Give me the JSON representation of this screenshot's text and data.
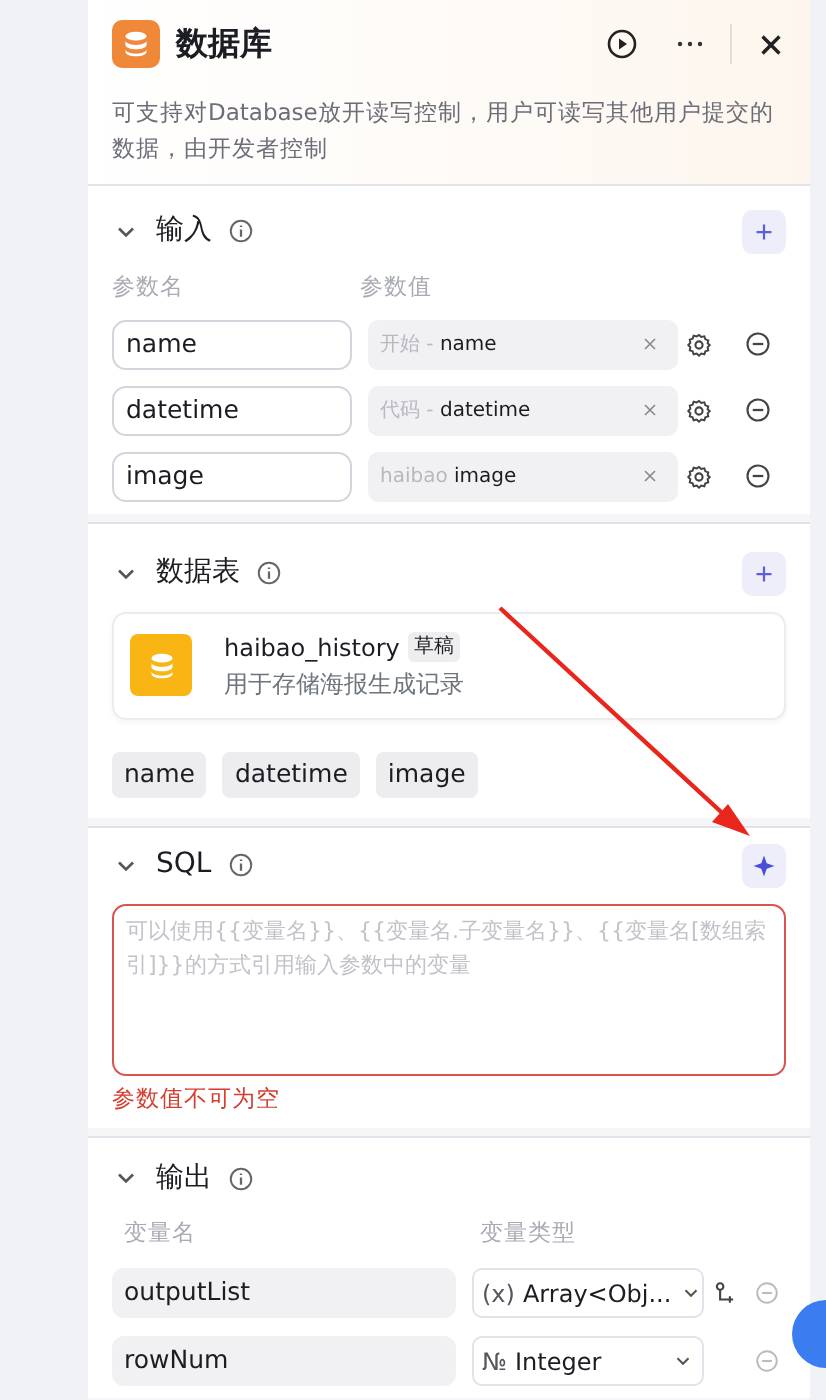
{
  "header": {
    "title": "数据库",
    "description": "可支持对Database放开读写控制，用户可读写其他用户提交的数据，由开发者控制"
  },
  "input": {
    "title": "输入",
    "expanded": true,
    "col_name": "参数名",
    "col_value": "参数值",
    "rows": [
      {
        "name": "name",
        "source": "开始 -",
        "variable": "name"
      },
      {
        "name": "datetime",
        "source": "代码 -",
        "variable": "datetime"
      },
      {
        "name": "image",
        "source": "haibao",
        "variable": "image"
      }
    ]
  },
  "table": {
    "title": "数据表",
    "expanded": true,
    "name": "haibao_history",
    "badge": "草稿",
    "description": "用于存储海报生成记录",
    "fields": [
      "name",
      "datetime",
      "image"
    ]
  },
  "sql": {
    "title": "SQL",
    "expanded": true,
    "placeholder": "可以使用{{变量名}}、{{变量名.子变量名}}、{{变量名[数组索引]}}的方式引用输入参数中的变量",
    "error": "参数值不可为空"
  },
  "output": {
    "title": "输出",
    "expanded": true,
    "col_name": "变量名",
    "col_type": "变量类型",
    "rows": [
      {
        "name": "outputList",
        "type_icon": "(x)",
        "type": "Array<Obj...",
        "kind": "array"
      },
      {
        "name": "rowNum",
        "type_icon": "№",
        "type": "Integer",
        "kind": "scalar"
      }
    ]
  },
  "annotation_arrow": true
}
